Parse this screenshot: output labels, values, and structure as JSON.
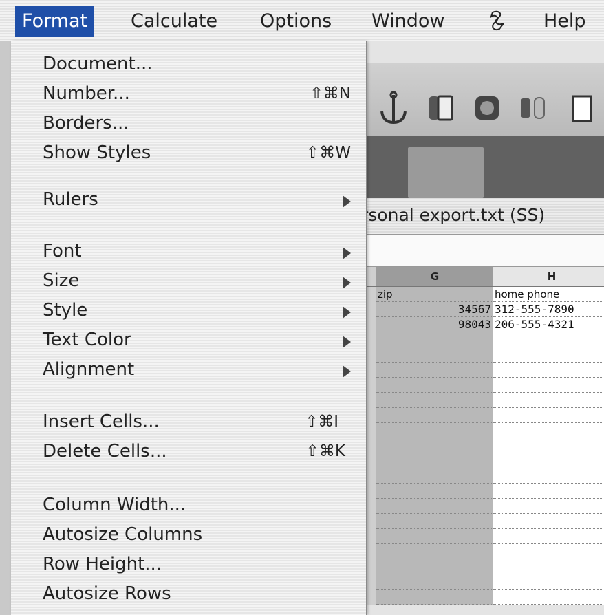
{
  "menubar": {
    "items": [
      "Format",
      "Calculate",
      "Options",
      "Window",
      "Help"
    ],
    "active": "Format",
    "script_icon": "script-menu-icon"
  },
  "window": {
    "title": "rsonal export.txt (SS)"
  },
  "spreadsheet": {
    "columns": [
      "G",
      "H"
    ],
    "header_row": [
      "zip",
      "home phone"
    ],
    "rows": [
      [
        "34567",
        "312-555-7890"
      ],
      [
        "98043",
        "206-555-4321"
      ]
    ]
  },
  "format_menu": {
    "items": [
      {
        "label": "Document...",
        "shortcut": "",
        "submenu": false
      },
      {
        "label": "Number...",
        "shortcut": "⇧⌘N",
        "submenu": false
      },
      {
        "label": "Borders...",
        "shortcut": "",
        "submenu": false
      },
      {
        "label": "Show Styles",
        "shortcut": "⇧⌘W",
        "submenu": false
      },
      {
        "label": "Rulers",
        "shortcut": "",
        "submenu": true
      },
      {
        "label": "Font",
        "shortcut": "",
        "submenu": true
      },
      {
        "label": "Size",
        "shortcut": "",
        "submenu": true
      },
      {
        "label": "Style",
        "shortcut": "",
        "submenu": true
      },
      {
        "label": "Text Color",
        "shortcut": "",
        "submenu": true
      },
      {
        "label": "Alignment",
        "shortcut": "",
        "submenu": true
      },
      {
        "label": "Insert Cells...",
        "shortcut": "⇧⌘I",
        "submenu": false
      },
      {
        "label": "Delete Cells...",
        "shortcut": "⇧⌘K",
        "submenu": false
      },
      {
        "label": "Column Width...",
        "shortcut": "",
        "submenu": false
      },
      {
        "label": "Autosize Columns",
        "shortcut": "",
        "submenu": false
      },
      {
        "label": "Row Height...",
        "shortcut": "",
        "submenu": false
      },
      {
        "label": "Autosize Rows",
        "shortcut": "",
        "submenu": false
      }
    ]
  },
  "colors": {
    "menu_highlight": "#1f4fa8",
    "selected_column": "#b8b8b8"
  }
}
